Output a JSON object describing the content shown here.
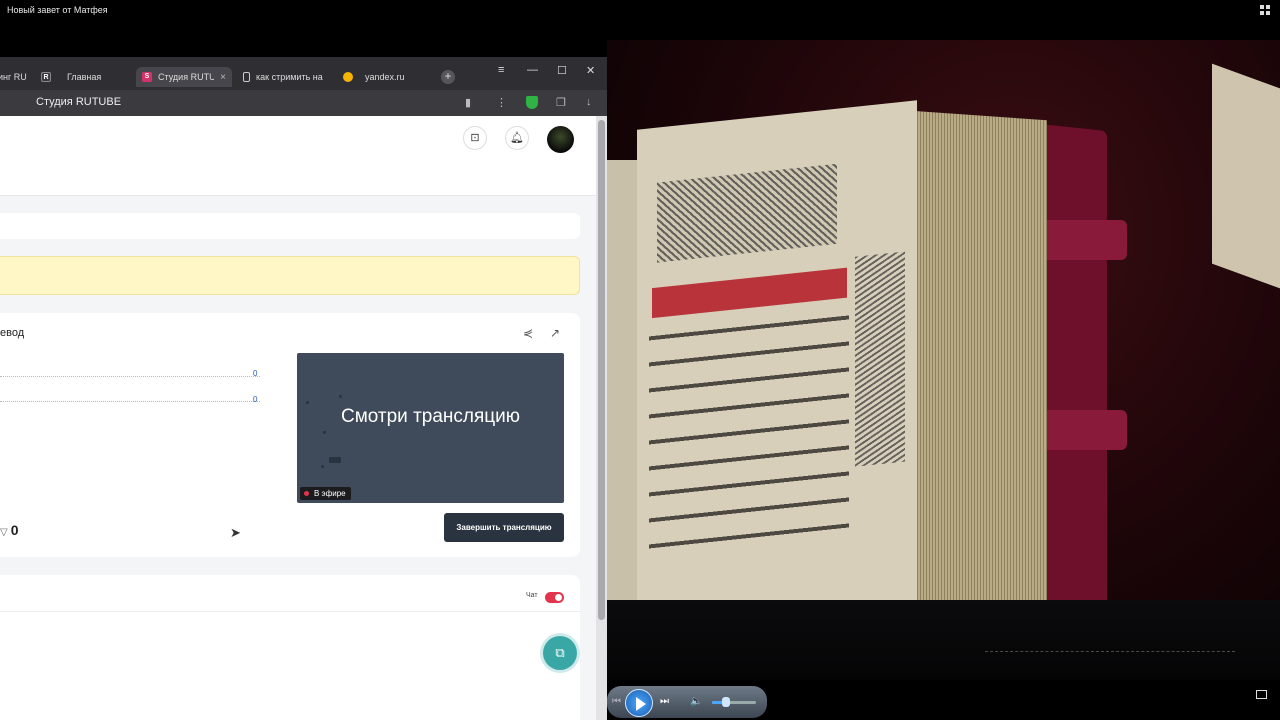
{
  "player": {
    "title": "Новый завет от Матфея",
    "menu_icon": "grid-icon",
    "controls": {
      "prev": "⏮",
      "next": "⏭",
      "volume": "🔈",
      "volume_level": 0.3
    }
  },
  "browser": {
    "tabs": [
      {
        "label": "инг RU",
        "favicon_color": "#cf2a4e"
      },
      {
        "label": "Главная",
        "favicon_letter": "R",
        "favicon_color": "#3a3a40"
      },
      {
        "label": "Студия RUTUBE",
        "favicon_letter": "S",
        "favicon_color": "#d4326b",
        "active": true
      },
      {
        "label": "как стримить на",
        "favicon_color": "#888888"
      },
      {
        "label": "yandex.ru",
        "favicon_color": "#f5b400"
      }
    ],
    "new_tab": "+",
    "window_buttons": {
      "menu": "≡",
      "minimize": "—",
      "maximize": "☐",
      "close": "✕"
    },
    "address_title": "Студия RUTUBE"
  },
  "studio": {
    "card_title": "евод",
    "stats": [
      {
        "value": "0"
      },
      {
        "value": "0"
      }
    ],
    "preview_text": "Смотри трансляцию",
    "live_badge": "В эфире",
    "likes": "0",
    "end_button": "Завершить трансляцию",
    "chat_label": "Чат",
    "chat_enabled": true,
    "accent": "#e2344a"
  }
}
